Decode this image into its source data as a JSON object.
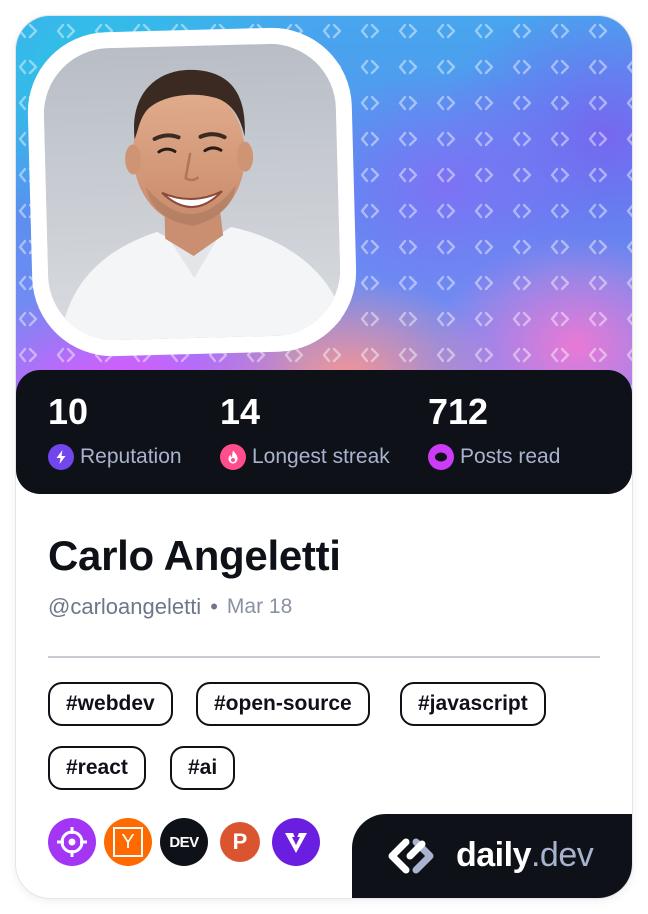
{
  "profile": {
    "name": "Carlo Angeletti",
    "handle": "@carloangeletti",
    "separator": "•",
    "date": "Mar 18"
  },
  "stats": [
    {
      "value": "10",
      "label": "Reputation",
      "icon": "lightning-icon",
      "color": "#7147ed"
    },
    {
      "value": "14",
      "label": "Longest streak",
      "icon": "flame-icon",
      "color": "#ff4d8d"
    },
    {
      "value": "712",
      "label": "Posts read",
      "icon": "ring-icon",
      "color": "#cc3bf5"
    }
  ],
  "tags": [
    "#webdev",
    "#open-source",
    "#javascript",
    "#react",
    "#ai"
  ],
  "sources": [
    {
      "name": "crosshair-source-icon",
      "color": "#a335f5"
    },
    {
      "name": "y-combinator-source-icon",
      "label": "Y",
      "color": "#ff6a00"
    },
    {
      "name": "dev-to-source-icon",
      "label": "DEV",
      "color": "#0e1117"
    },
    {
      "name": "product-hunt-source-icon",
      "label": "P",
      "color": "#da552f"
    },
    {
      "name": "vercel-v-source-icon",
      "color": "#6a1fe0"
    }
  ],
  "brand": {
    "name": "daily",
    "tld": ".dev"
  },
  "colors": {
    "background_dark": "#0e1117",
    "stat_label": "#a8b3cf",
    "handle": "#6f7689"
  }
}
